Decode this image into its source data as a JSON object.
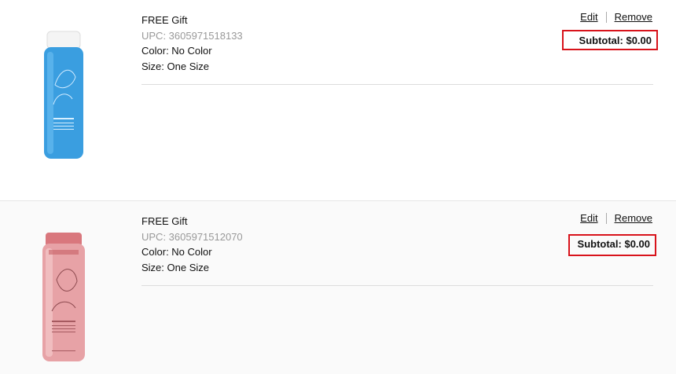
{
  "items": [
    {
      "name": "FREE Gift",
      "upc": "UPC: 3605971518133",
      "color": "Color: No Color",
      "size": "Size: One Size",
      "edit_label": "Edit",
      "remove_label": "Remove",
      "subtotal": "Subtotal: $0.00",
      "image_icon": "blue-bottle-product-image",
      "bottle_color": "#3a9ee0"
    },
    {
      "name": "FREE Gift",
      "upc": "UPC: 3605971512070",
      "color": "Color: No Color",
      "size": "Size: One Size",
      "edit_label": "Edit",
      "remove_label": "Remove",
      "subtotal": "Subtotal: $0.00",
      "image_icon": "pink-bottle-product-image",
      "bottle_color": "#e7a2a6"
    }
  ],
  "highlight_color": "#d8131b"
}
